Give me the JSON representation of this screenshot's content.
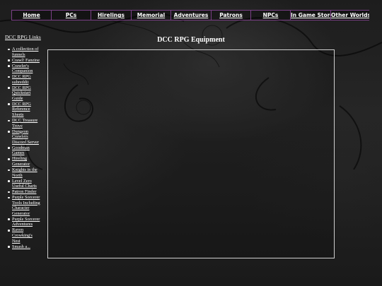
{
  "nav": {
    "items": [
      {
        "label": "Home"
      },
      {
        "label": "PCs"
      },
      {
        "label": "Hirelings"
      },
      {
        "label": "Memorial"
      },
      {
        "label": "Adventures"
      },
      {
        "label": "Patrons"
      },
      {
        "label": "NPCs"
      },
      {
        "label": "In Game Store"
      },
      {
        "label": "Other Worlds"
      }
    ]
  },
  "sidebar": {
    "title": "DCC RPG Links",
    "links": [
      "A collection of funnels",
      "Crawl! Fanzine",
      "Crawler's Companion",
      "DCC RPG subreddit",
      "DCC RPG Quickstart Guide",
      "DCC RPG Reference Sheets",
      "DCC Treasure Trove",
      "Dungeon Crawlers Discord Server",
      "Goodman Games",
      "Hireling Generator",
      "Knights in the North",
      "Level Zero Useful Charts",
      "Patron Finder",
      "Purple Sorcerer Tools Including Character Generator",
      "Purple Sorcerer Adventures",
      "Raven Crowking's Nest",
      "Smash a..."
    ]
  },
  "main": {
    "title": "DCC RPG Equipment"
  },
  "colors": {
    "nav_border": "#7a3f86",
    "frame_border": "#cfcfcf"
  }
}
